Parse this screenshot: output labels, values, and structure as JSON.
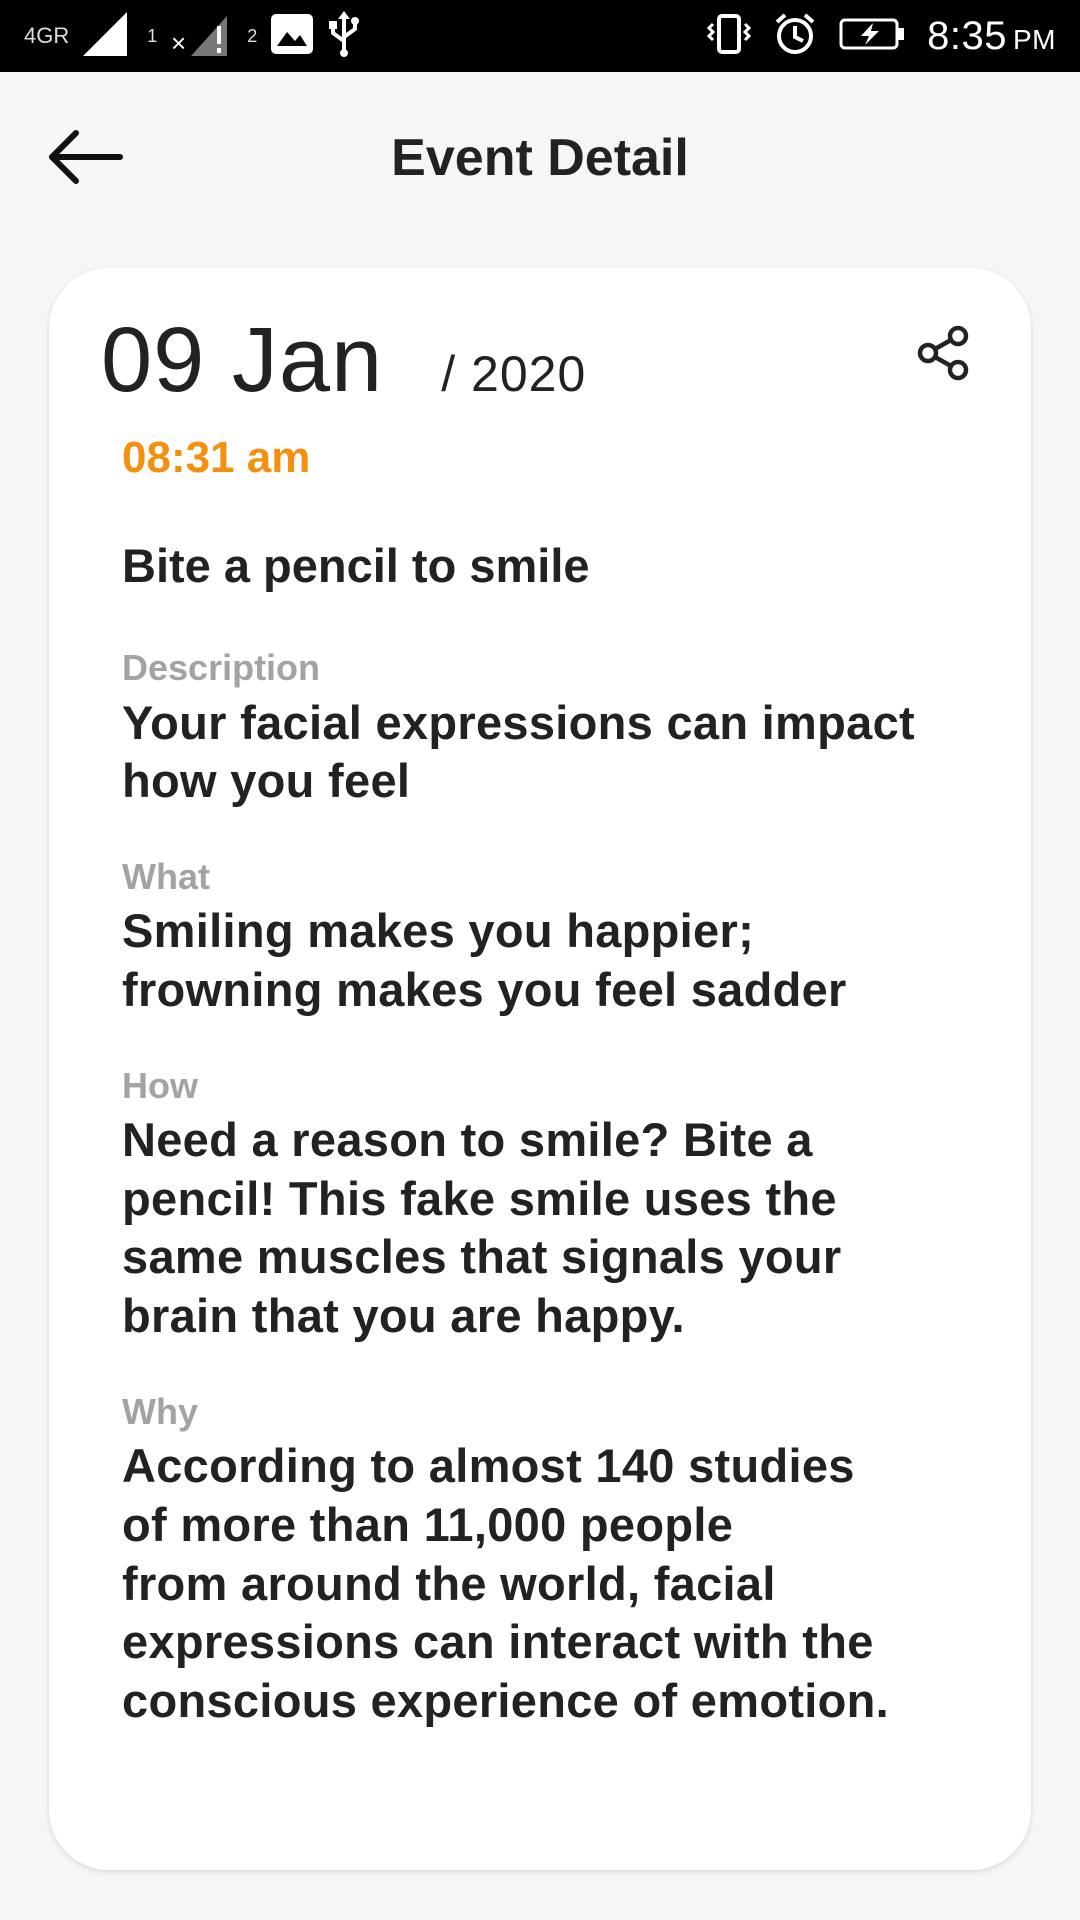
{
  "status_bar": {
    "network": "4GR",
    "sim1": "1",
    "sim2": "2",
    "time": "8:35",
    "ampm": "PM"
  },
  "header": {
    "title": "Event Detail"
  },
  "event": {
    "date_day_month": "09 Jan",
    "date_year": "/ 2020",
    "time": "08:31 am",
    "title": "Bite a pencil to smile",
    "sections": [
      {
        "label": "Description",
        "text": "Your facial expressions can impact\nhow you feel"
      },
      {
        "label": "What",
        "text": "Smiling makes you happier;\nfrowning makes you feel sadder"
      },
      {
        "label": "How",
        "text": "Need a reason to smile? Bite a\npencil! This fake smile uses the\nsame muscles that signals your\nbrain that you are happy."
      },
      {
        "label": "Why",
        "text": "According to almost 140 studies\nof more than 11,000 people\nfrom around the world, facial\nexpressions can interact with the\nconscious experience of emotion."
      }
    ]
  },
  "colors": {
    "accent": "#f5900f",
    "label_gray": "#a3a3a3",
    "text": "#222222",
    "background": "#f6f6f6"
  }
}
